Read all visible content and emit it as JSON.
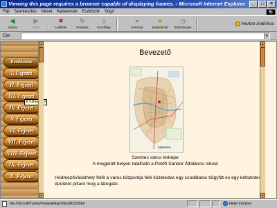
{
  "window": {
    "title": "Viewing this page requires a browser capable of displaying frames. - Microsoft Internet Explorer",
    "buttons": [
      "_",
      "□",
      "×"
    ]
  },
  "menu": [
    "Fájl",
    "Szerkesztés",
    "Nézet",
    "Kedvencek",
    "Eszközök",
    "Súgó"
  ],
  "toolbar": {
    "back": "Vissza",
    "forward": "Előre",
    "stop": "Leállítás",
    "refresh": "Frissítés",
    "home": "Kezdőlap",
    "search": "Keresés",
    "favorites": "Kedvencek",
    "history": "Előzmények",
    "norton": "Norton AntiVirus"
  },
  "address": {
    "label": "Cím",
    "value": ""
  },
  "nav": {
    "items": [
      "Kezdőoldal",
      "I. Fejezet",
      "II. Fejezet",
      "III. Fejezet",
      "IV. Fejezet",
      "V. Fejezet",
      "VI. Fejezet",
      "VII. Fejezet",
      "VIII. Fejezet",
      "IX. Fejezet",
      "X. Fejezet"
    ],
    "tooltip": "A Tulhtajsikló"
  },
  "main": {
    "heading": "Bevezető",
    "map_label": "SZENTES",
    "caption1": "Szentes város térképe",
    "caption2": "A megjelölt helyen található a Petőfi Sándor Általános Iskola",
    "paragraph": "Hódmezővásárhely felől a város központja felé közeledve egy csodálatos tölgyfát és egy kétszintes épületet pillant meg a látogató."
  },
  "status": {
    "text": "file://d/zsofi/Tanits/maskalt/kaz/htm/l8t33/htm",
    "zone": "Helyi intranet"
  },
  "colors": {
    "title_bar": "#0a2a8a",
    "page_bg": "#fff4e0",
    "nav_button": "#c07a20"
  }
}
